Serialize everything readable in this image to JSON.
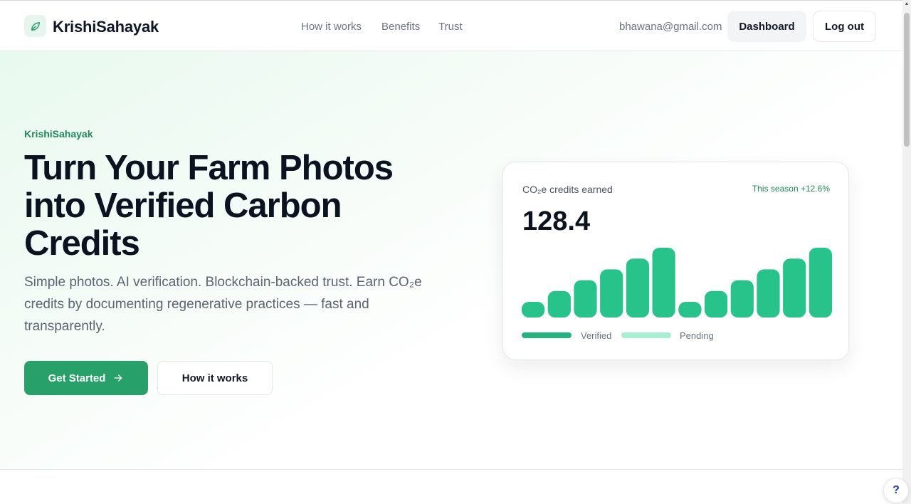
{
  "header": {
    "brand": "KrishiSahayak",
    "nav": [
      "How it works",
      "Benefits",
      "Trust"
    ],
    "email": "bhawana@gmail.com",
    "dashboard_label": "Dashboard",
    "logout_label": "Log out"
  },
  "hero": {
    "eyebrow": "KrishiSahayak",
    "title": "Turn Your Farm Photos into Verified Carbon Credits",
    "subtitle": "Simple photos. AI verification. Blockchain-backed trust. Earn CO₂e credits by documenting regenerative practices — fast and transparently.",
    "primary_cta": "Get Started",
    "secondary_cta": "How it works"
  },
  "card": {
    "title": "CO₂e credits earned",
    "badge": "This season  +12.6%",
    "value": "128.4",
    "legend": [
      "Verified",
      "Pending"
    ]
  },
  "colors": {
    "accent": "#27a06a",
    "bar": "#28c38a",
    "pending": "#a7f0cf"
  },
  "chart_data": {
    "type": "bar",
    "series": [
      {
        "values": [
          1,
          2,
          3,
          4,
          5,
          6,
          1,
          2,
          3,
          4,
          5,
          6
        ]
      }
    ]
  },
  "help_label": "?"
}
